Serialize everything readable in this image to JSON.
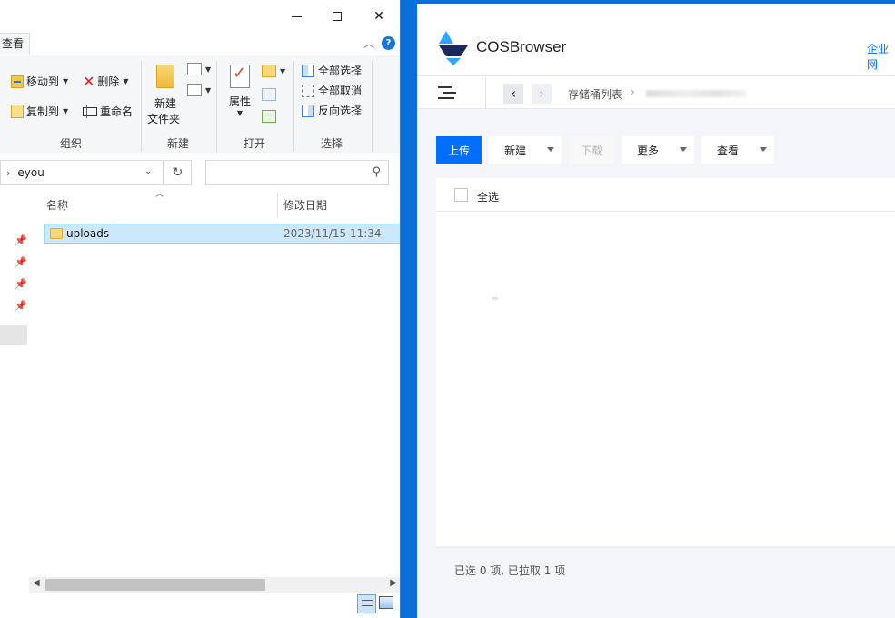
{
  "explorer": {
    "ribbon": {
      "tab_view": "查看",
      "move_to": "移动到",
      "copy_to": "复制到",
      "delete": "删除",
      "rename": "重命名",
      "new_folder_line1": "新建",
      "new_folder_line2": "文件夹",
      "properties": "属性",
      "select_all": "全部选择",
      "select_none": "全部取消",
      "invert_selection": "反向选择",
      "groups": {
        "organize": "组织",
        "new": "新建",
        "open": "打开",
        "select": "选择"
      }
    },
    "address": {
      "current_folder": "eyou",
      "search_placeholder": ""
    },
    "columns": {
      "name": "名称",
      "modified": "修改日期"
    },
    "files": [
      {
        "name": "uploads",
        "modified": "2023/11/15 11:34"
      }
    ]
  },
  "cos": {
    "app_title": "COSBrowser",
    "corp_link": "企业网",
    "breadcrumb": {
      "root": "存储桶列表"
    },
    "toolbar": {
      "upload": "上传",
      "new": "新建",
      "download": "下载",
      "more": "更多",
      "view": "查看"
    },
    "list": {
      "select_all": "全选"
    },
    "footer": {
      "status": "已选 0 项, 已拉取 1 项"
    },
    "colors": {
      "primary": "#006eff",
      "logo_dark": "#1a2a5c",
      "logo_light": "#2aa6ff"
    }
  }
}
